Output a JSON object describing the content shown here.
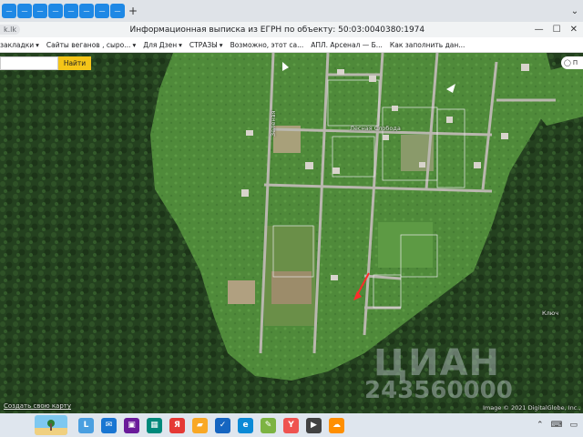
{
  "tabs": {
    "items": [
      {
        "icon": "tab-favicon",
        "color": "#1e88e5"
      },
      {
        "icon": "tab-favicon",
        "color": "#1e88e5"
      },
      {
        "icon": "tab-favicon",
        "color": "#1e88e5"
      },
      {
        "icon": "tab-favicon",
        "color": "#1e88e5"
      },
      {
        "icon": "tab-favicon",
        "color": "#1e88e5"
      },
      {
        "icon": "tab-favicon",
        "color": "#1e88e5"
      },
      {
        "icon": "tab-favicon",
        "color": "#1e88e5"
      },
      {
        "icon": "tab-favicon",
        "color": "#1e88e5"
      }
    ],
    "new_tab": "+"
  },
  "addressbar": {
    "url_chip": "k.lk",
    "page_title": "Информационная выписка из ЕГРН по объекту: 50:03:0040380:1974",
    "minimize": "—",
    "maximize": "☐",
    "close": "✕"
  },
  "bookmarks": [
    {
      "label": "закладки",
      "arrow": "▾"
    },
    {
      "label": "Сайты веганов , сыро...",
      "arrow": "▾"
    },
    {
      "label": "Для Дзен",
      "arrow": "▾"
    },
    {
      "label": "СТРАЗЫ",
      "arrow": "▾"
    },
    {
      "label": "Возможно, этот са..."
    },
    {
      "label": "АПЛ. Арсенал — Б..."
    },
    {
      "label": "Как заполнить дан..."
    }
  ],
  "map": {
    "search_placeholder": "",
    "search_button": "Найти",
    "layer_button": "П",
    "labels": {
      "street_vertical": "Зеленая",
      "lesnaya": "Лесная Слобода",
      "small": "Ключ"
    },
    "create_map_link": "Создать свою карту",
    "copyright": "Image © 2021 DigitalGlobe, Inc., ©",
    "watermark_brand": "ЦИАН",
    "watermark_id": "243560000"
  },
  "taskbar": {
    "icons": [
      {
        "name": "learning-icon",
        "glyph": "L",
        "color": "#4a9fe0"
      },
      {
        "name": "mail-icon",
        "glyph": "✉",
        "color": "#1976d2"
      },
      {
        "name": "media-icon",
        "glyph": "▣",
        "color": "#6a1b9a"
      },
      {
        "name": "photos-icon",
        "glyph": "▦",
        "color": "#00897b"
      },
      {
        "name": "yandex-icon",
        "glyph": "Я",
        "color": "#e53935"
      },
      {
        "name": "folder-icon",
        "glyph": "▰",
        "color": "#f9a825"
      },
      {
        "name": "check-icon",
        "glyph": "✓",
        "color": "#1565c0"
      },
      {
        "name": "edge-icon",
        "glyph": "e",
        "color": "#0b8ad6"
      },
      {
        "name": "tools-icon",
        "glyph": "✎",
        "color": "#7cb342"
      },
      {
        "name": "yandex-browser-icon",
        "glyph": "Y",
        "color": "#ef5350"
      },
      {
        "name": "player-icon",
        "glyph": "▶",
        "color": "#424242"
      },
      {
        "name": "weather-icon",
        "glyph": "☁",
        "color": "#ff8f00"
      }
    ],
    "tray_up": "⌃",
    "tray_keyboard": "⌨",
    "tray_chat": "▭"
  }
}
